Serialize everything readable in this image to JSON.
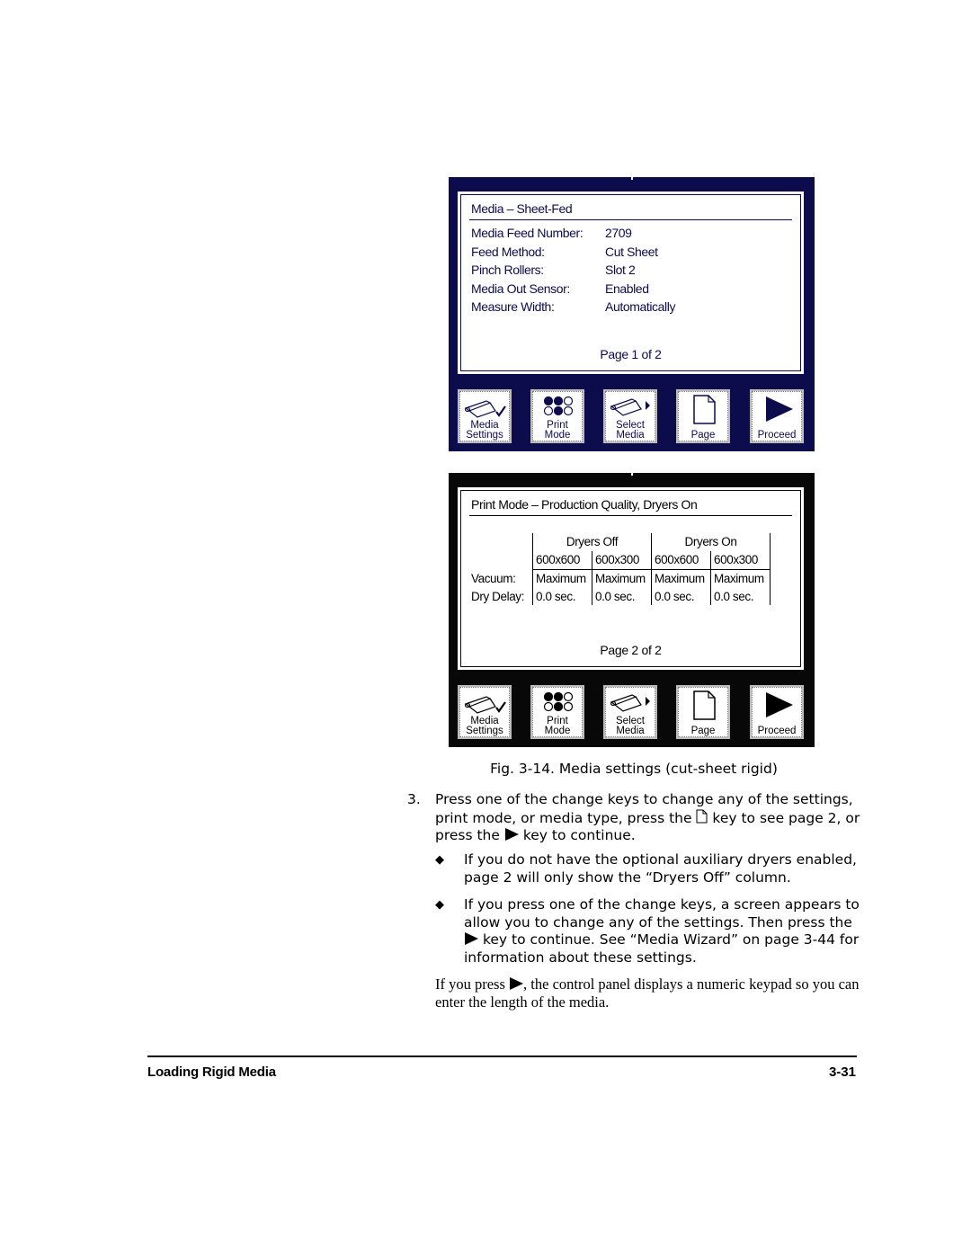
{
  "figure": {
    "panels": [
      {
        "title": "Media – Sheet-Fed",
        "fields": [
          {
            "label": "Media Feed Number:",
            "value": "2709"
          },
          {
            "label": "Feed Method:",
            "value": "Cut Sheet"
          },
          {
            "label": "Pinch Rollers:",
            "value": "Slot 2"
          },
          {
            "label": "Media Out Sensor:",
            "value": "Enabled"
          },
          {
            "label": "Measure Width:",
            "value": "Automatically"
          }
        ],
        "page_indicator": "Page 1 of 2",
        "frame_color": "#0c0c4c"
      },
      {
        "title": "Print Mode – Production Quality, Dryers On",
        "table": {
          "groups": [
            "Dryers Off",
            "Dryers On"
          ],
          "columns": [
            "600x600",
            "600x300",
            "600x600",
            "600x300"
          ],
          "rows": [
            {
              "label": "Vacuum:",
              "cells": [
                "Maximum",
                "Maximum",
                "Maximum",
                "Maximum"
              ]
            },
            {
              "label": "Dry Delay:",
              "cells": [
                "0.0 sec.",
                "0.0 sec.",
                "0.0 sec.",
                "0.0 sec."
              ]
            }
          ]
        },
        "page_indicator": "Page 2 of 2",
        "frame_color": "#080808"
      }
    ],
    "buttons": [
      {
        "line1": "Media",
        "line2": "Settings",
        "icon": "media-roll-check-icon"
      },
      {
        "line1": "Print",
        "line2": "Mode",
        "icon": "print-mode-dots-icon"
      },
      {
        "line1": "Select",
        "line2": "Media",
        "icon": "media-roll-arrow-icon"
      },
      {
        "line1": "",
        "line2": "Page",
        "icon": "page-icon"
      },
      {
        "line1": "",
        "line2": "Proceed",
        "icon": "play-arrow-icon"
      }
    ],
    "caption": "Fig. 3-14. Media settings (cut-sheet rigid)"
  },
  "step": {
    "number": "3.",
    "text_part1": "Press one of the change keys to change any of the settings, print mode, or media type, press the",
    "text_part2": "key to see page 2, or press the",
    "text_part3": "key to continue."
  },
  "bullets": [
    {
      "text": "If you do not have the optional auxiliary dryers enabled, page 2 will only show the “Dryers Off” column."
    },
    {
      "text_part1": "If you press one of the change keys, a screen appears to allow you to change any of the settings. Then press the",
      "text_part2": "key to continue. See “Media Wizard” on page 3-44 for information about these settings."
    }
  ],
  "closing": {
    "text_part1": "If you press",
    "text_part2": ", the control panel displays a numeric keypad so you can enter the length of the media."
  },
  "footer": {
    "section": "Loading Rigid Media",
    "page": "3-31"
  }
}
